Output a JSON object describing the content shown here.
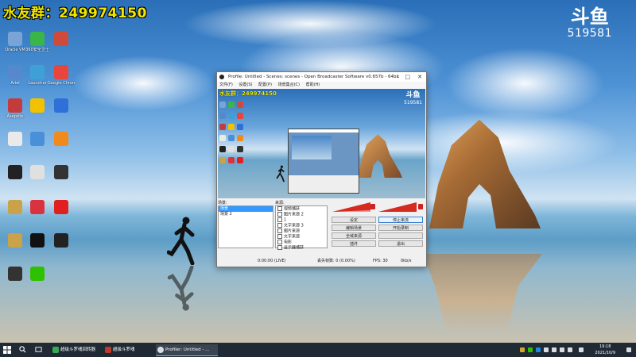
{
  "watermark": {
    "qq_group": "水友群：249974150",
    "douyu_mark": "斗鱼",
    "room_id": "519581"
  },
  "desktop_icons": [
    {
      "id": "icon-1",
      "label": "Oracle VM",
      "color": "#7aa3d6"
    },
    {
      "id": "icon-2",
      "label": "360安全卫士",
      "color": "#39b54a"
    },
    {
      "id": "icon-3",
      "label": "",
      "color": "#d04a3a"
    },
    {
      "id": "icon-4",
      "label": "Ariel",
      "color": "#5588cc"
    },
    {
      "id": "icon-5",
      "label": "Launcher",
      "color": "#3fa0d8"
    },
    {
      "id": "icon-6",
      "label": "Google Chrome",
      "color": "#e8453c"
    },
    {
      "id": "icon-7",
      "label": "Aseprite",
      "color": "#c43b3b"
    },
    {
      "id": "icon-8",
      "label": "",
      "color": "#f2c200"
    },
    {
      "id": "icon-9",
      "label": "",
      "color": "#2e6fd8"
    },
    {
      "id": "icon-10",
      "label": "",
      "color": "#eaeaea"
    },
    {
      "id": "icon-11",
      "label": "",
      "color": "#4a90d9"
    },
    {
      "id": "icon-12",
      "label": "",
      "color": "#f08a1c"
    },
    {
      "id": "icon-13",
      "label": "",
      "color": "#222222"
    },
    {
      "id": "icon-14",
      "label": "",
      "color": "#e0e0e0"
    },
    {
      "id": "icon-15",
      "label": "",
      "color": "#333333"
    },
    {
      "id": "icon-16",
      "label": "",
      "color": "#c9a24a"
    },
    {
      "id": "icon-17",
      "label": "",
      "color": "#d9333f"
    },
    {
      "id": "icon-18",
      "label": "",
      "color": "#e02020"
    },
    {
      "id": "icon-19",
      "label": "",
      "color": "#c9a24a"
    },
    {
      "id": "icon-20",
      "label": "",
      "color": "#111111"
    },
    {
      "id": "icon-21",
      "label": "",
      "color": "#222222"
    },
    {
      "id": "icon-22",
      "label": "",
      "color": "#333333"
    },
    {
      "id": "icon-23",
      "label": "",
      "color": "#2dc100"
    }
  ],
  "obs": {
    "title": "Profile: Untitled - Scenes: scenes - Open Broadcaster Software v0.657b - 64bit",
    "menu": [
      "文件(F)",
      "设置(S)",
      "配置(P)",
      "场景集合(C)",
      "帮助(H)"
    ],
    "scenes_label": "场景:",
    "scenes": [
      {
        "name": "场景",
        "selected": true
      },
      {
        "name": "场景 2",
        "selected": false
      }
    ],
    "sources_label": "来源:",
    "sources": [
      "视频捕获",
      "图片来源 2",
      "1",
      "文字来源 3",
      "图片来源",
      "文字来源",
      "电影",
      "显示器捕获"
    ],
    "buttons": {
      "settings": "设定",
      "stop_stream": "停止串流",
      "edit_scene": "编辑场景",
      "start_recording": "开始录制",
      "global_sources": "全域来源",
      "plugins": "插件",
      "exit": "退出"
    },
    "status": {
      "time": "0:00:00 (LIVE)",
      "dropped": "丢失帧数: 0 (0.00%)",
      "fps": "FPS: 30",
      "bitrate": "0kb/s"
    }
  },
  "taskbar": {
    "items": [
      {
        "label": "",
        "color": "#ffffff"
      },
      {
        "label": "超级斗罗魂回转器",
        "color": "#3aa956"
      },
      {
        "label": "超级斗罗魂",
        "color": "#c0392b"
      },
      {
        "label": "Profiler: Untitled - ...",
        "color": "#dddddd"
      }
    ],
    "time": "19:18",
    "date": "2021/10/9"
  }
}
